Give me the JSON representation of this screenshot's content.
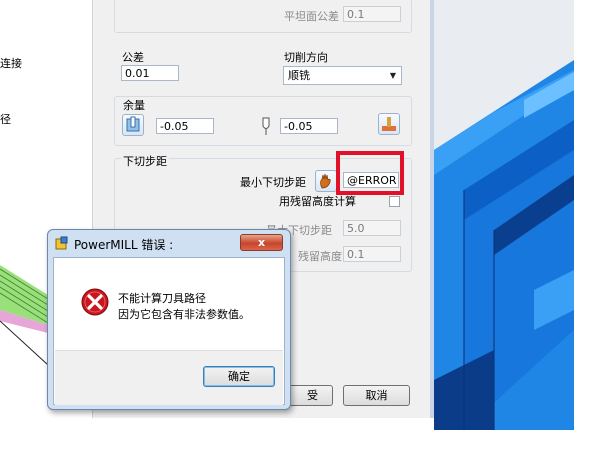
{
  "left_panel": {
    "label_connect": "连接",
    "label_partial": "径"
  },
  "dialog": {
    "flat_tolerance_label": "平坦面公差",
    "flat_tolerance_value": "0.1",
    "tolerance_label": "公差",
    "tolerance_value": "0.01",
    "cut_direction_label": "切削方向",
    "cut_direction_value": "顺铣",
    "allowance_label": "余量",
    "radial_allowance_value": "-0.05",
    "axial_allowance_value": "-0.05",
    "stepdown_group_label": "下切步距",
    "min_stepdown_label": "最小下切步距",
    "min_stepdown_value": "@ERROR",
    "use_cusp_label": "用残留高度计算",
    "max_stepdown_label": "最大下切步距",
    "max_stepdown_value": "5.0",
    "cusp_height_label": "残留高度",
    "cusp_height_value": "0.1",
    "accept_button_partial": "受",
    "cancel_button": "取消"
  },
  "error_dialog": {
    "title": "PowerMILL 错误 :",
    "close_label": "x",
    "message_line1": "不能计算刀具路径",
    "message_line2": "因为它包含有非法参数值。",
    "ok_button": "确定"
  },
  "colors": {
    "part_blue": "#1f86e6",
    "part_dark": "#0b3c8a",
    "highlight_red": "#e3102a",
    "error_red": "#c8171e"
  }
}
